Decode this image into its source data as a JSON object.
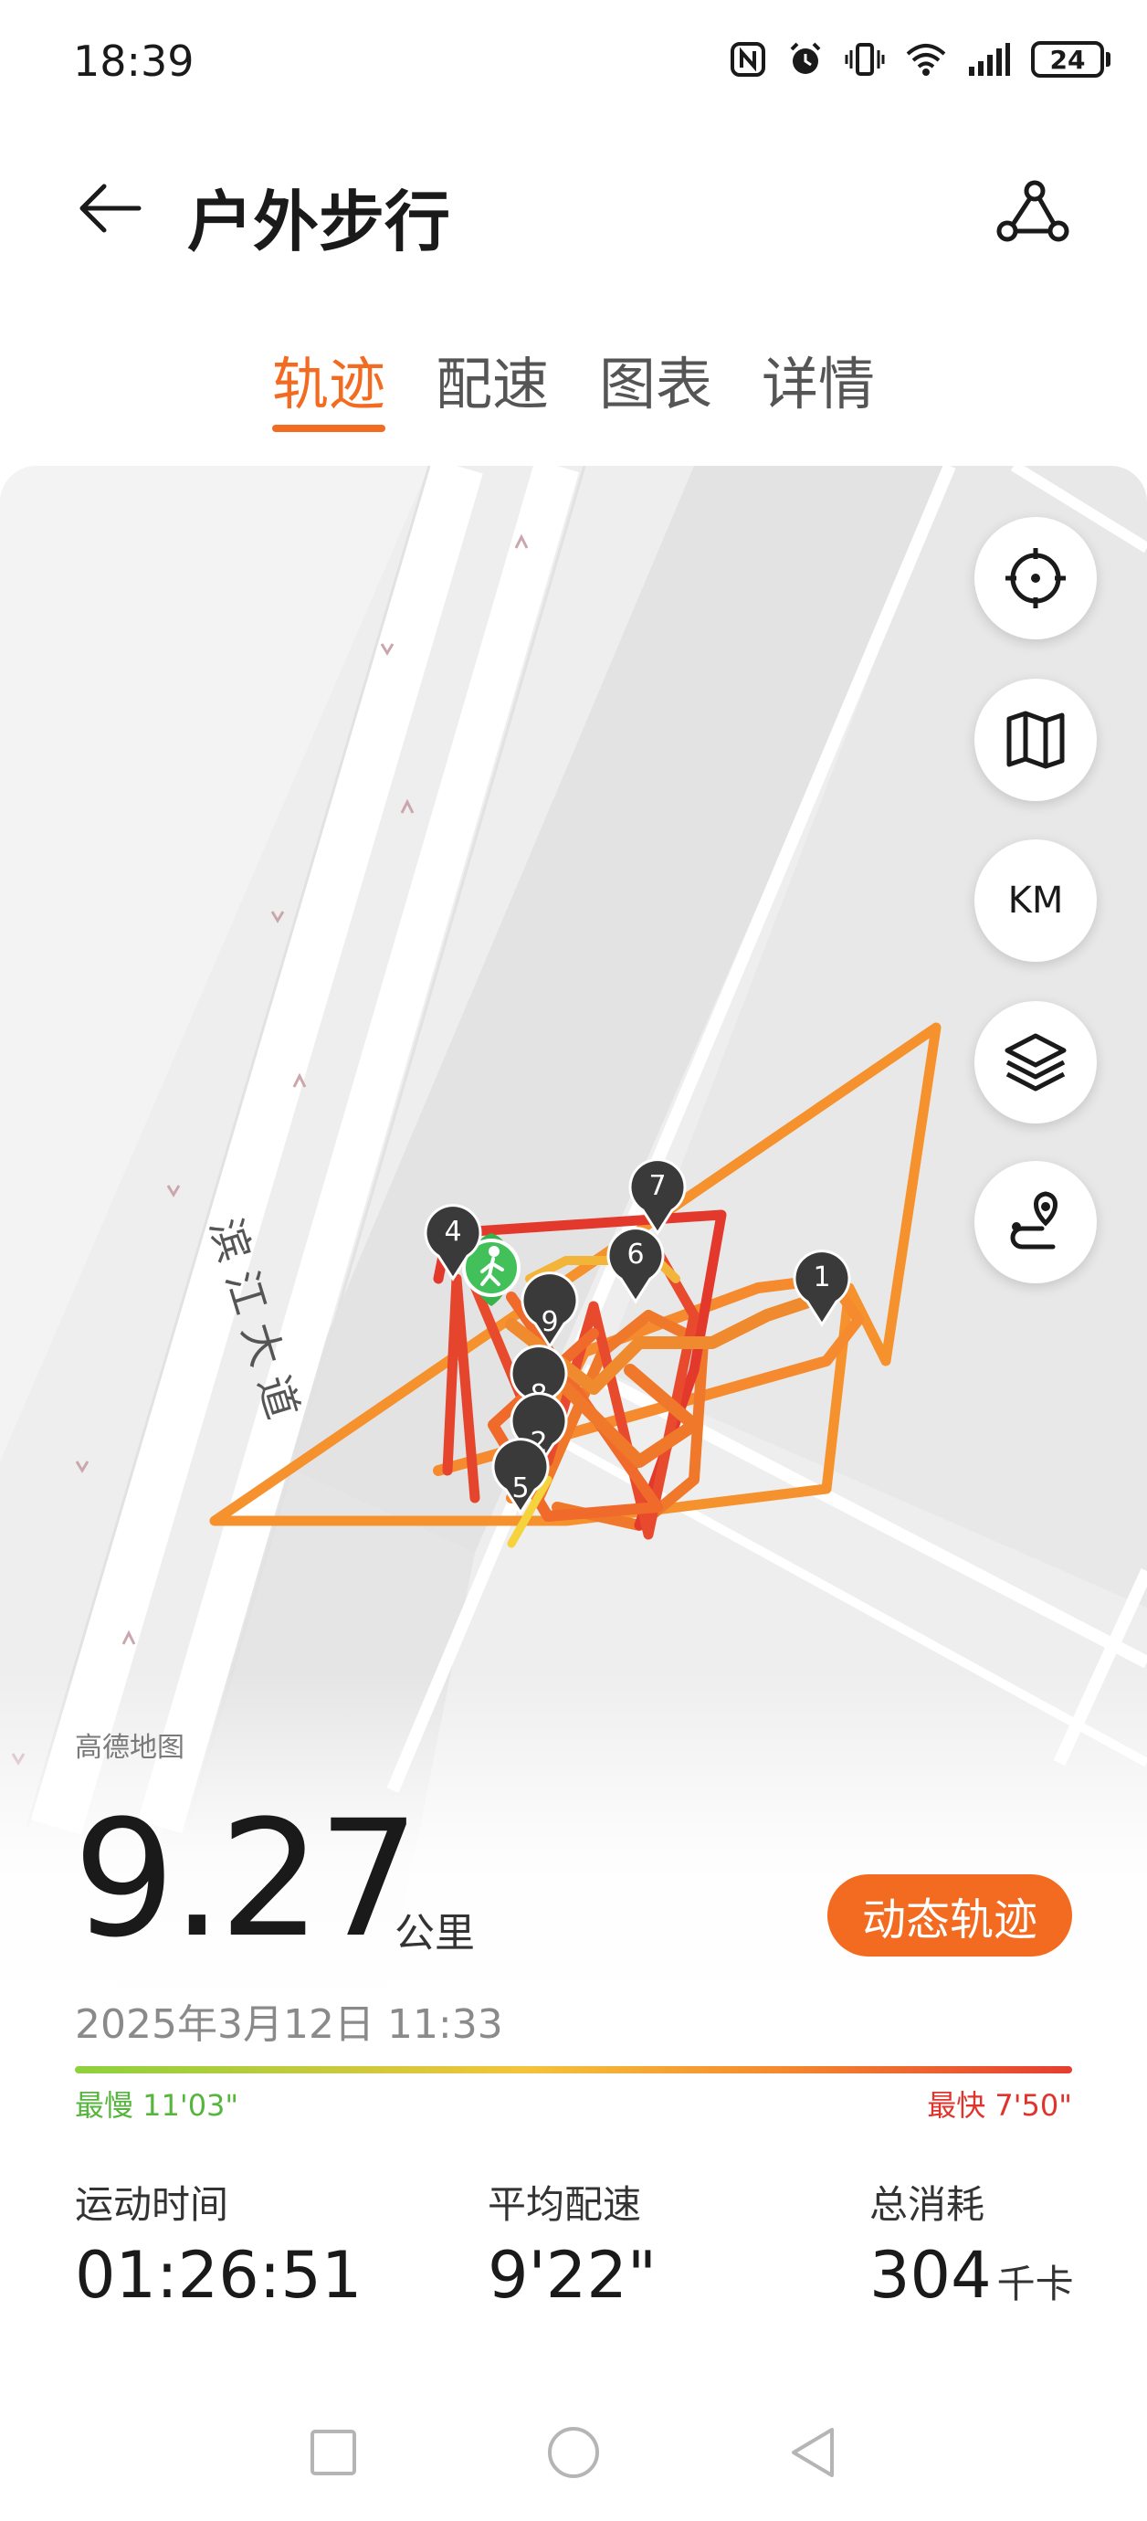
{
  "status_bar": {
    "time": "18:39",
    "battery": "24",
    "icons": [
      "nfc-icon",
      "alarm-icon",
      "vibrate-icon",
      "wifi-icon",
      "signal-icon",
      "battery-icon"
    ]
  },
  "header": {
    "title": "户外步行",
    "back_icon": "arrow-left-icon",
    "route_icon": "route-share-icon"
  },
  "tabs": [
    {
      "label": "轨迹",
      "active": true
    },
    {
      "label": "配速",
      "active": false
    },
    {
      "label": "图表",
      "active": false
    },
    {
      "label": "详情",
      "active": false
    }
  ],
  "map": {
    "road_label": "滨江大道",
    "provider": "高德地图",
    "markers": [
      "1",
      "2",
      "4",
      "5",
      "6",
      "7",
      "8",
      "9"
    ],
    "start_icon": "walking-person-icon",
    "controls": [
      {
        "name": "locate-icon"
      },
      {
        "name": "map-icon"
      },
      {
        "name": "km-toggle",
        "label": "KM"
      },
      {
        "name": "layers-icon"
      },
      {
        "name": "route-location-icon"
      }
    ],
    "track_colors": {
      "slow": "#f6c33a",
      "medium": "#f5922e",
      "fast": "#e3392c"
    }
  },
  "summary": {
    "distance": "9.27",
    "distance_unit": "公里",
    "dynamic_button": "动态轨迹",
    "date": "2025年3月12日 11:33",
    "slowest_label": "最慢 11'03\"",
    "fastest_label": "最快 7'50\"",
    "stats": [
      {
        "label": "运动时间",
        "value": "01:26:51",
        "unit": ""
      },
      {
        "label": "平均配速",
        "value": "9'22\"",
        "unit": ""
      },
      {
        "label": "总消耗",
        "value": "304",
        "unit": "千卡"
      }
    ]
  },
  "nav": {
    "buttons": [
      "recents-square-icon",
      "home-circle-icon",
      "back-triangle-icon"
    ]
  },
  "colors": {
    "accent": "#f26b21",
    "slow_green": "#55b53c",
    "fast_red": "#e0332c"
  }
}
